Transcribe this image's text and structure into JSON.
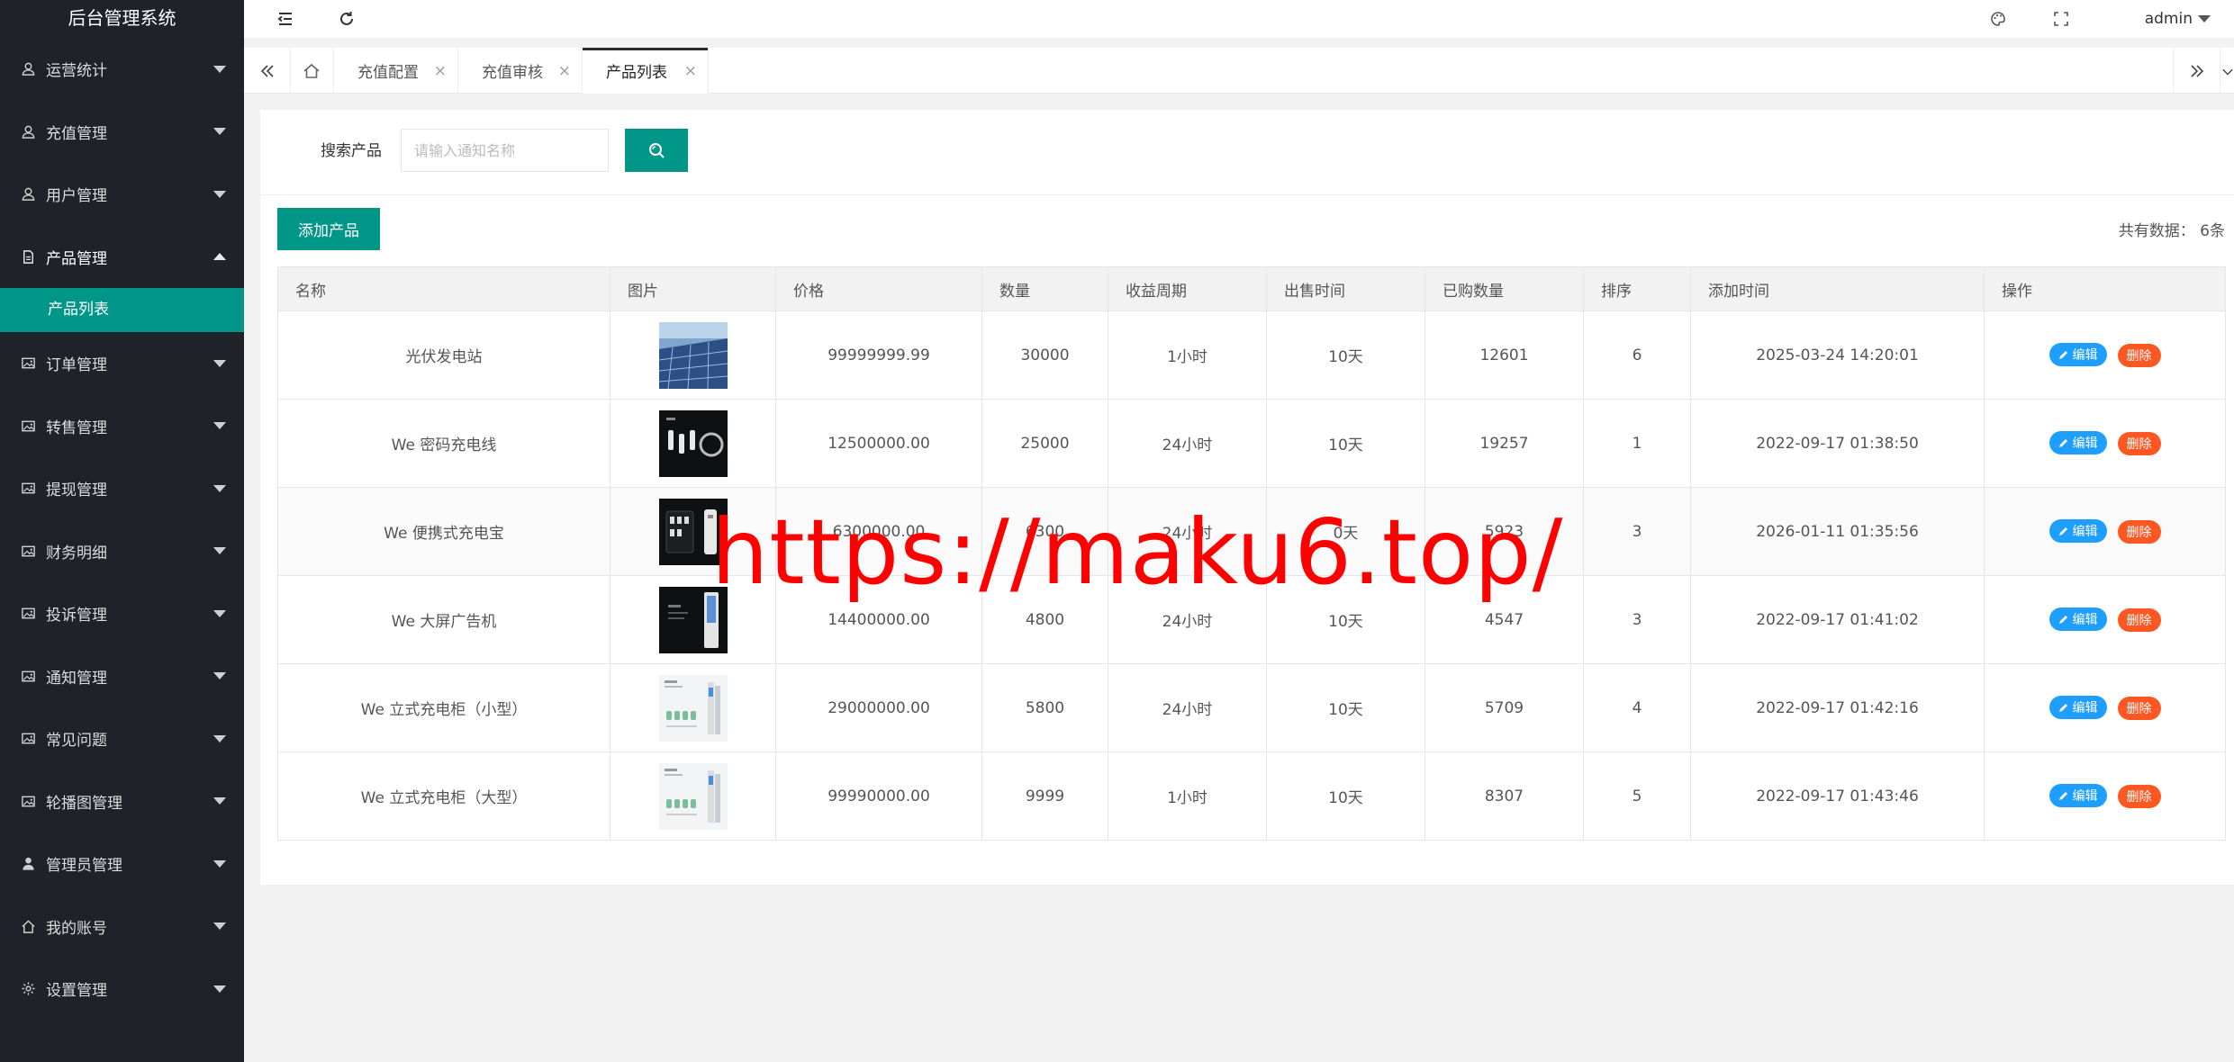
{
  "app": {
    "title": "后台管理系统"
  },
  "sidebar": {
    "items": [
      {
        "label": "运营统计",
        "icon": "user-icon"
      },
      {
        "label": "充值管理",
        "icon": "user-icon"
      },
      {
        "label": "用户管理",
        "icon": "user-icon"
      },
      {
        "label": "产品管理",
        "icon": "file-icon",
        "open": true,
        "sub": "产品列表"
      },
      {
        "label": "订单管理",
        "icon": "image-icon"
      },
      {
        "label": "转售管理",
        "icon": "image-icon"
      },
      {
        "label": "提现管理",
        "icon": "image-icon"
      },
      {
        "label": "财务明细",
        "icon": "image-icon"
      },
      {
        "label": "投诉管理",
        "icon": "image-icon"
      },
      {
        "label": "通知管理",
        "icon": "image-icon"
      },
      {
        "label": "常见问题",
        "icon": "image-icon"
      },
      {
        "label": "轮播图管理",
        "icon": "image-icon"
      },
      {
        "label": "管理员管理",
        "icon": "person-icon"
      },
      {
        "label": "我的账号",
        "icon": "home-icon"
      },
      {
        "label": "设置管理",
        "icon": "gear-icon"
      }
    ]
  },
  "header": {
    "user": "admin"
  },
  "tabs": [
    {
      "label": "充值配置"
    },
    {
      "label": "充值审核"
    },
    {
      "label": "产品列表",
      "active": true
    }
  ],
  "search": {
    "label": "搜索产品",
    "placeholder": "请输入通知名称"
  },
  "toolbar": {
    "add_label": "添加产品",
    "total_text": "共有数据： 6条"
  },
  "table": {
    "columns": [
      "名称",
      "图片",
      "价格",
      "数量",
      "收益周期",
      "出售时间",
      "已购数量",
      "排序",
      "添加时间",
      "操作"
    ],
    "rows": [
      {
        "name": "光伏发电站",
        "thumb": "solar",
        "price": "99999999.99",
        "qty": "30000",
        "cycle": "1小时",
        "sale": "10天",
        "bought": "12601",
        "sort": "6",
        "added": "2025-03-24 14:20:01"
      },
      {
        "name": "We 密码充电线",
        "thumb": "cable",
        "price": "12500000.00",
        "qty": "25000",
        "cycle": "24小时",
        "sale": "10天",
        "bought": "19257",
        "sort": "1",
        "added": "2022-09-17 01:38:50"
      },
      {
        "name": "We 便携式充电宝",
        "thumb": "powerbank",
        "price": "6300000.00",
        "qty": "6300",
        "cycle": "24小时",
        "sale": "0天",
        "bought": "5923",
        "sort": "3",
        "added": "2026-01-11 01:35:56"
      },
      {
        "name": "We 大屏广告机",
        "thumb": "screen",
        "price": "14400000.00",
        "qty": "4800",
        "cycle": "24小时",
        "sale": "10天",
        "bought": "4547",
        "sort": "3",
        "added": "2022-09-17 01:41:02"
      },
      {
        "name": "We 立式充电柜（小型）",
        "thumb": "cabinet",
        "price": "29000000.00",
        "qty": "5800",
        "cycle": "24小时",
        "sale": "10天",
        "bought": "5709",
        "sort": "4",
        "added": "2022-09-17 01:42:16"
      },
      {
        "name": "We 立式充电柜（大型）",
        "thumb": "cabinet",
        "price": "99990000.00",
        "qty": "9999",
        "cycle": "1小时",
        "sale": "10天",
        "bought": "8307",
        "sort": "5",
        "added": "2022-09-17 01:43:46"
      }
    ],
    "edit_label": "编辑",
    "delete_label": "删除"
  },
  "watermark": "https://maku6.top/",
  "colors": {
    "sidebar_bg": "#20222a",
    "accent": "#009688",
    "edit": "#1e9fff",
    "delete": "#ff5722",
    "watermark": "#ff0000"
  }
}
